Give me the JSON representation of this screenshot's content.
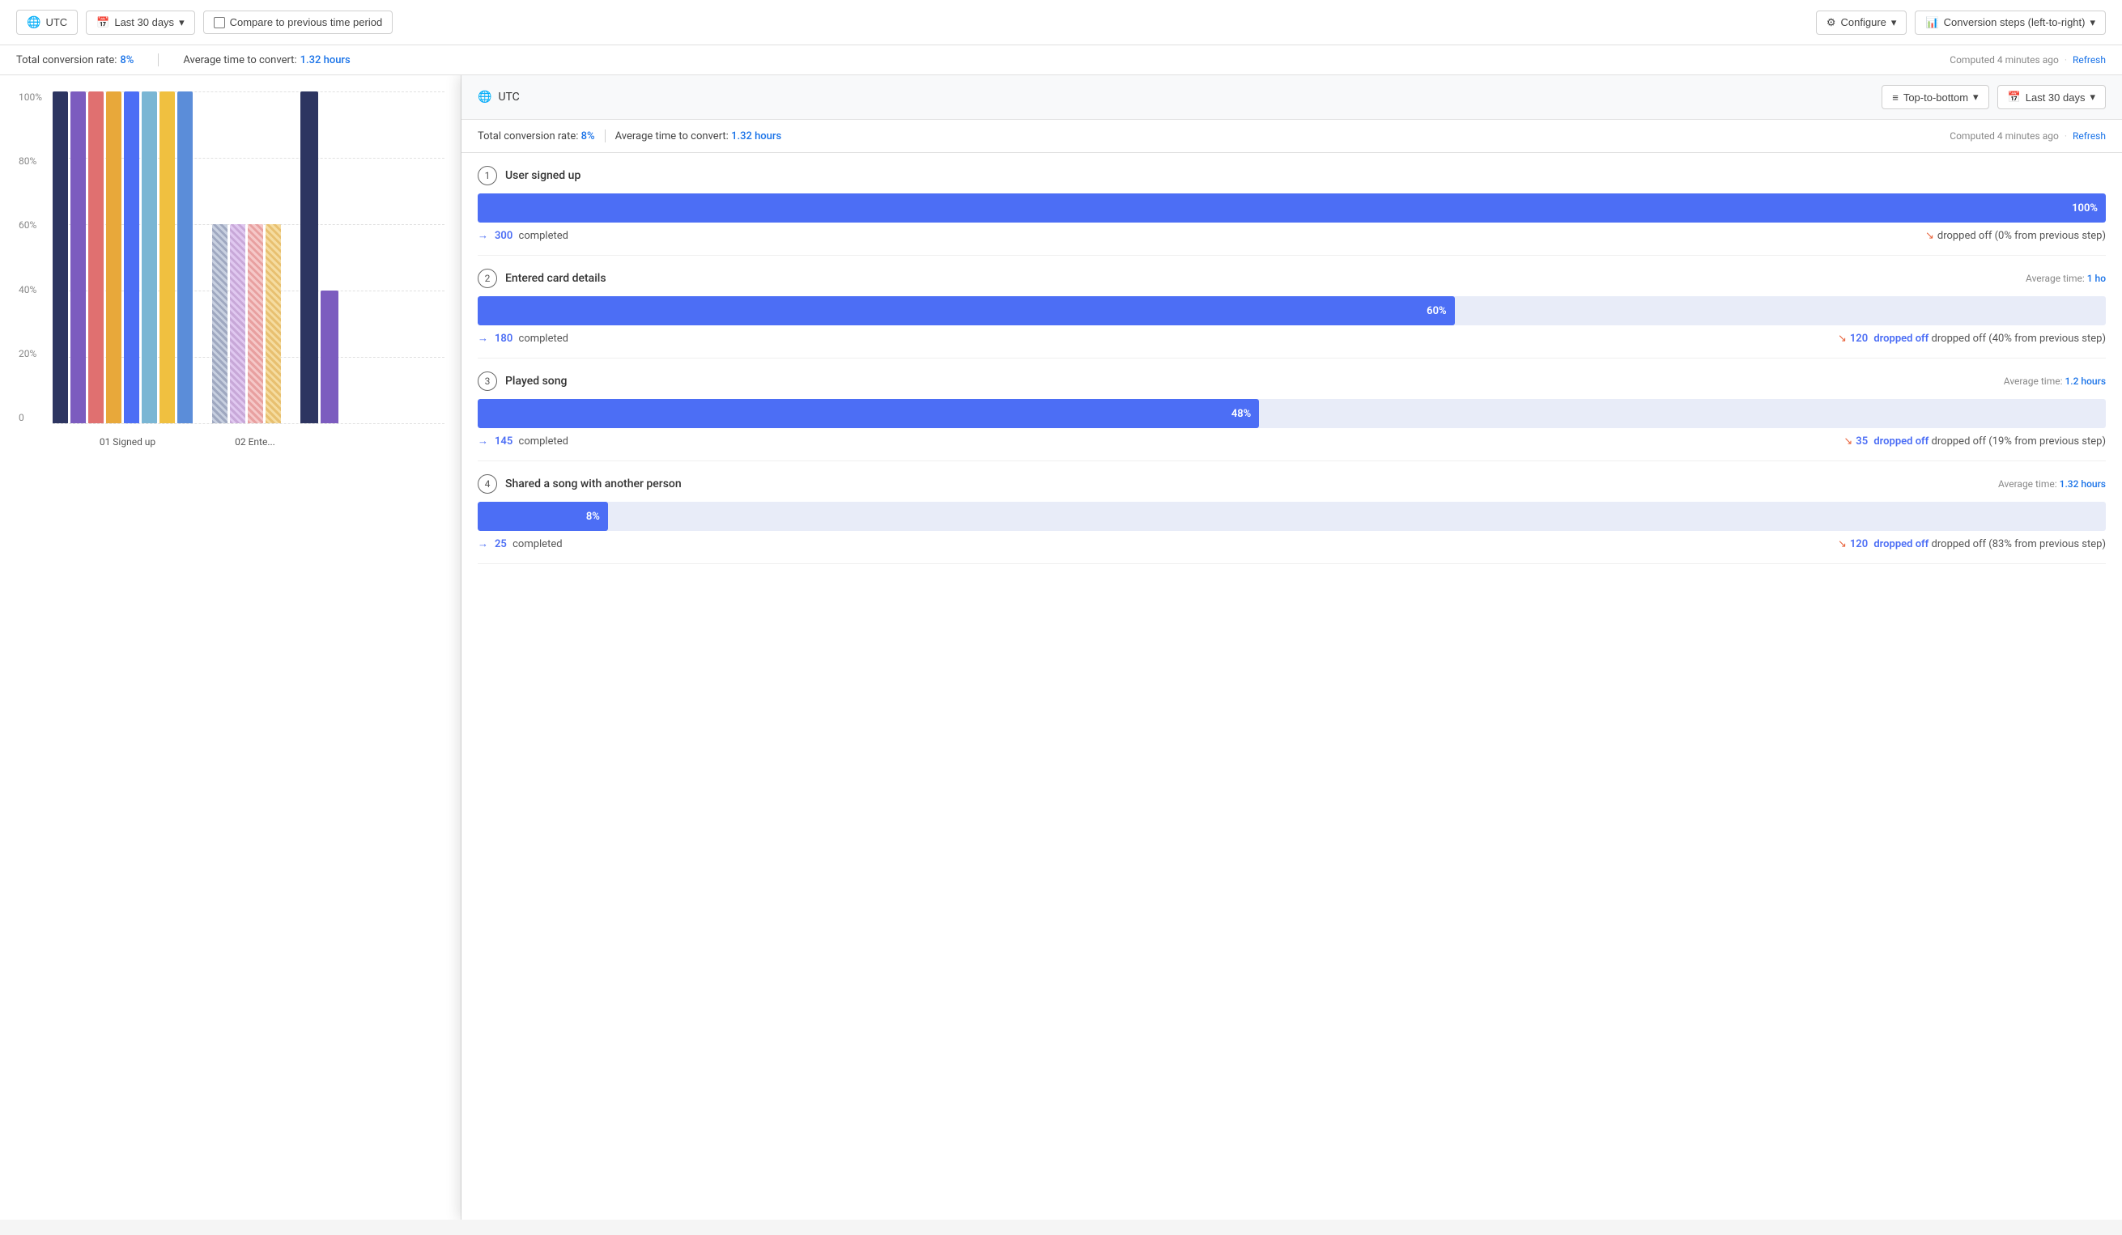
{
  "topbar": {
    "utc_label": "UTC",
    "date_range_label": "Last 30 days",
    "compare_label": "Compare to previous time period",
    "configure_label": "Configure",
    "conversion_steps_label": "Conversion steps (left-to-right)"
  },
  "stats_bar": {
    "conversion_rate_label": "Total conversion rate:",
    "conversion_rate_value": "8%",
    "avg_time_label": "Average time to convert:",
    "avg_time_value": "1.32 hours",
    "computed_label": "Computed 4 minutes ago",
    "refresh_label": "Refresh"
  },
  "chart": {
    "y_labels": [
      "100%",
      "80%",
      "60%",
      "40%",
      "20%",
      "0"
    ],
    "step_labels": [
      "01 Signed up",
      "02 Ente..."
    ],
    "bar_colors": [
      "#2d3561",
      "#7c5cbf",
      "#e07070",
      "#e8a83a",
      "#4c6ef5",
      "#7ab6d4",
      "#f0c040",
      "#5b8dd9"
    ],
    "hatch_bars": true
  },
  "overlay": {
    "utc_label": "UTC",
    "orientation_label": "Top-to-bottom",
    "date_range_label": "Last 30 days",
    "stats": {
      "conversion_rate_label": "Total conversion rate:",
      "conversion_rate_value": "8%",
      "avg_time_label": "Average time to convert:",
      "avg_time_value": "1.32 hours",
      "computed_label": "Computed 4 minutes ago",
      "refresh_label": "Refresh"
    },
    "steps": [
      {
        "number": "1",
        "title": "User signed up",
        "avg_time": null,
        "percent": 100,
        "percent_label": "100%",
        "completed_count": "300",
        "completed_label": "completed",
        "dropped_count": "0",
        "dropped_label": "dropped off (0% from previous step)"
      },
      {
        "number": "2",
        "title": "Entered card details",
        "avg_time": "Average time: ",
        "avg_time_value": "1 ho",
        "percent": 60,
        "percent_label": "60%",
        "completed_count": "180",
        "completed_label": "completed",
        "dropped_count": "120",
        "dropped_label": "dropped off (40% from previous step)"
      },
      {
        "number": "3",
        "title": "Played song",
        "avg_time": "Average time: ",
        "avg_time_value": "1.2 hours",
        "percent": 48,
        "percent_label": "48%",
        "completed_count": "145",
        "completed_label": "completed",
        "dropped_count": "35",
        "dropped_label": "dropped off (19% from previous step)"
      },
      {
        "number": "4",
        "title": "Shared a song with another person",
        "avg_time": "Average time: ",
        "avg_time_value": "1.32 hours",
        "percent": 8,
        "percent_label": "8%",
        "completed_count": "25",
        "completed_label": "completed",
        "dropped_count": "120",
        "dropped_label": "dropped off (83% from previous step)"
      }
    ]
  }
}
